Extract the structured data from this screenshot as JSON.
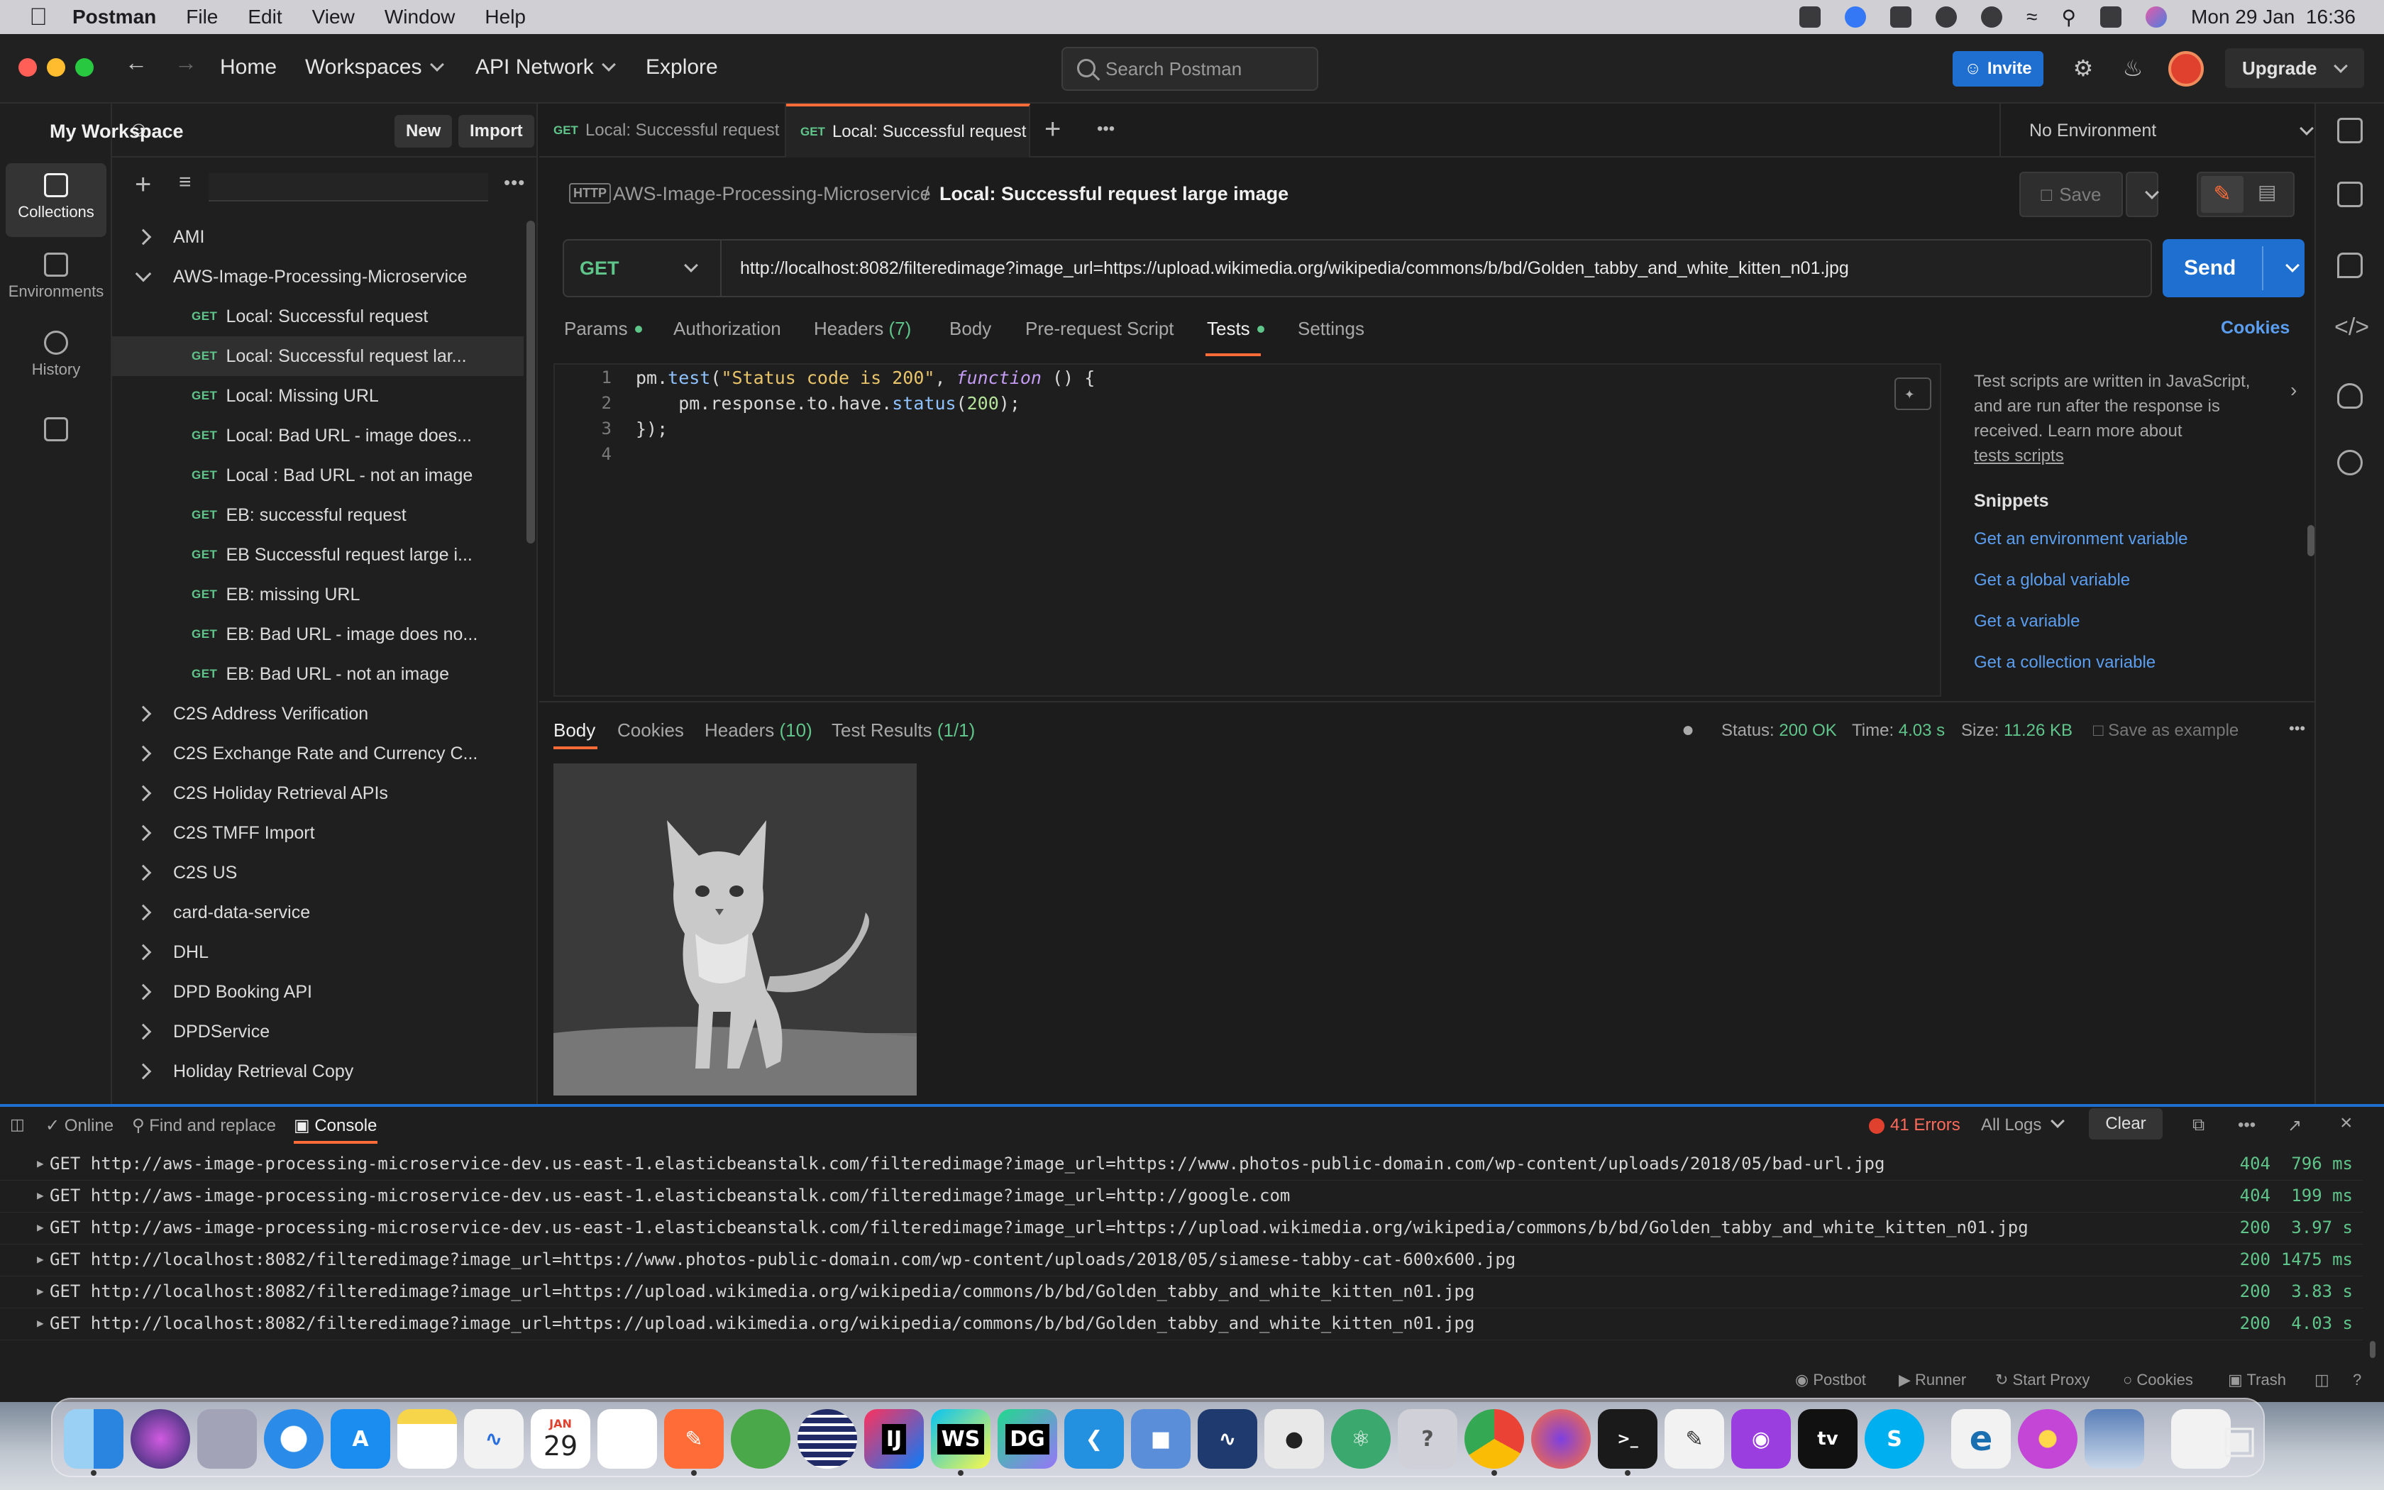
{
  "menubar": {
    "app": "Postman",
    "items": [
      "File",
      "Edit",
      "View",
      "Window",
      "Help"
    ],
    "datetime": "Mon 29 Jan  16:36"
  },
  "titlebar": {
    "nav": [
      "Home",
      "Workspaces",
      "API Network",
      "Explore"
    ],
    "search_placeholder": "Search Postman",
    "invite": "Invite",
    "upgrade": "Upgrade"
  },
  "rail": [
    "Collections",
    "Environments",
    "History"
  ],
  "sidebar": {
    "workspace": "My Workspace",
    "new_btn": "New",
    "import_btn": "Import",
    "tree": [
      {
        "type": "folder",
        "label": "AMI",
        "open": false
      },
      {
        "type": "folder",
        "label": "AWS-Image-Processing-Microservice",
        "open": true
      },
      {
        "type": "req",
        "method": "GET",
        "label": "Local: Successful request"
      },
      {
        "type": "req",
        "method": "GET",
        "label": "Local: Successful request lar...",
        "selected": true
      },
      {
        "type": "req",
        "method": "GET",
        "label": "Local: Missing URL"
      },
      {
        "type": "req",
        "method": "GET",
        "label": "Local: Bad URL - image does..."
      },
      {
        "type": "req",
        "method": "GET",
        "label": "Local : Bad URL - not an image"
      },
      {
        "type": "req",
        "method": "GET",
        "label": "EB: successful request"
      },
      {
        "type": "req",
        "method": "GET",
        "label": "EB Successful request large i..."
      },
      {
        "type": "req",
        "method": "GET",
        "label": "EB: missing URL"
      },
      {
        "type": "req",
        "method": "GET",
        "label": "EB: Bad URL - image does no..."
      },
      {
        "type": "req",
        "method": "GET",
        "label": "EB: Bad URL - not an image"
      },
      {
        "type": "folder",
        "label": "C2S Address Verification",
        "open": false
      },
      {
        "type": "folder",
        "label": "C2S Exchange Rate and Currency C...",
        "open": false
      },
      {
        "type": "folder",
        "label": "C2S Holiday Retrieval APIs",
        "open": false
      },
      {
        "type": "folder",
        "label": "C2S TMFF Import",
        "open": false
      },
      {
        "type": "folder",
        "label": "C2S US",
        "open": false
      },
      {
        "type": "folder",
        "label": "card-data-service",
        "open": false
      },
      {
        "type": "folder",
        "label": "DHL",
        "open": false
      },
      {
        "type": "folder",
        "label": "DPD Booking API",
        "open": false
      },
      {
        "type": "folder",
        "label": "DPDService",
        "open": false
      },
      {
        "type": "folder",
        "label": "Holiday Retrieval Copy",
        "open": false
      }
    ]
  },
  "tabs": {
    "items": [
      {
        "method": "GET",
        "label": "Local: Successful request",
        "active": false
      },
      {
        "method": "GET",
        "label": "Local: Successful request",
        "active": true
      }
    ],
    "environment": "No Environment"
  },
  "request": {
    "breadcrumb_parent": "AWS-Image-Processing-Microservice",
    "breadcrumb_sep": "/",
    "breadcrumb_current": "Local: Successful request large image",
    "save": "Save",
    "method": "GET",
    "url": "http://localhost:8082/filteredimage?image_url=https://upload.wikimedia.org/wikipedia/commons/b/bd/Golden_tabby_and_white_kitten_n01.jpg",
    "send": "Send",
    "tabs": {
      "params": "Params",
      "authorization": "Authorization",
      "headers": "Headers",
      "headers_count": "(7)",
      "body": "Body",
      "prerequest": "Pre-request Script",
      "tests": "Tests",
      "settings": "Settings"
    },
    "cookies": "Cookies"
  },
  "editor": {
    "line_numbers": [
      "1",
      "2",
      "3",
      "4"
    ],
    "line1": {
      "a": "pm.",
      "fn": "test",
      "b": "(",
      "str": "\"Status code is 200\"",
      "c": ", ",
      "kw": "function",
      "d": " () {"
    },
    "line2": {
      "a": "    pm.response.to.have.",
      "fn": "status",
      "b": "(",
      "num": "200",
      "c": ");"
    },
    "line3": "});"
  },
  "snippets": {
    "info1": "Test scripts are written in JavaScript,",
    "info2": "and are run after the response is",
    "info3": "received. Learn more about",
    "info_link": "tests scripts",
    "title": "Snippets",
    "links": [
      "Get an environment variable",
      "Get a global variable",
      "Get a variable",
      "Get a collection variable"
    ]
  },
  "response": {
    "tabs": {
      "body": "Body",
      "cookies": "Cookies",
      "headers": "Headers",
      "headers_count": "(10)",
      "tests": "Test Results",
      "tests_count": "(1/1)"
    },
    "status_label": "Status:",
    "status_value": "200 OK",
    "time_label": "Time:",
    "time_value": "4.03 s",
    "size_label": "Size:",
    "size_value": "11.26 KB",
    "save_example": "Save as example"
  },
  "console": {
    "online": "Online",
    "find": "Find and replace",
    "console": "Console",
    "errors": "41 Errors",
    "all_logs": "All Logs",
    "clear": "Clear",
    "logs": [
      {
        "text": "GET http://aws-image-processing-microservice-dev.us-east-1.elasticbeanstalk.com/filteredimage?image_url=https://www.photos-public-domain.com/wp-content/uploads/2018/05/bad-url.jpg",
        "status": "404",
        "time": "796 ms"
      },
      {
        "text": "GET http://aws-image-processing-microservice-dev.us-east-1.elasticbeanstalk.com/filteredimage?image_url=http://google.com",
        "status": "404",
        "time": "199 ms"
      },
      {
        "text": "GET http://aws-image-processing-microservice-dev.us-east-1.elasticbeanstalk.com/filteredimage?image_url=https://upload.wikimedia.org/wikipedia/commons/b/bd/Golden_tabby_and_white_kitten_n01.jpg",
        "status": "200",
        "time": "3.97 s"
      },
      {
        "text": "GET http://localhost:8082/filteredimage?image_url=https://www.photos-public-domain.com/wp-content/uploads/2018/05/siamese-tabby-cat-600x600.jpg",
        "status": "200",
        "time": "1475 ms"
      },
      {
        "text": "GET http://localhost:8082/filteredimage?image_url=https://upload.wikimedia.org/wikipedia/commons/b/bd/Golden_tabby_and_white_kitten_n01.jpg",
        "status": "200",
        "time": "3.83 s"
      },
      {
        "text": "GET http://localhost:8082/filteredimage?image_url=https://upload.wikimedia.org/wikipedia/commons/b/bd/Golden_tabby_and_white_kitten_n01.jpg",
        "status": "200",
        "time": "4.03 s"
      }
    ]
  },
  "statusbar": [
    "Postbot",
    "Runner",
    "Start Proxy",
    "Cookies",
    "Trash"
  ],
  "dock": {
    "calendar_month": "JAN",
    "calendar_day": "29",
    "intellij": "IJ",
    "webstorm": "WS",
    "datagrip": "DG",
    "help": "?",
    "tv": "tv",
    "edge": "e"
  },
  "colors": {
    "accent": "#ff6c37",
    "primary": "#1f6fd1",
    "success": "#5fc58a"
  }
}
